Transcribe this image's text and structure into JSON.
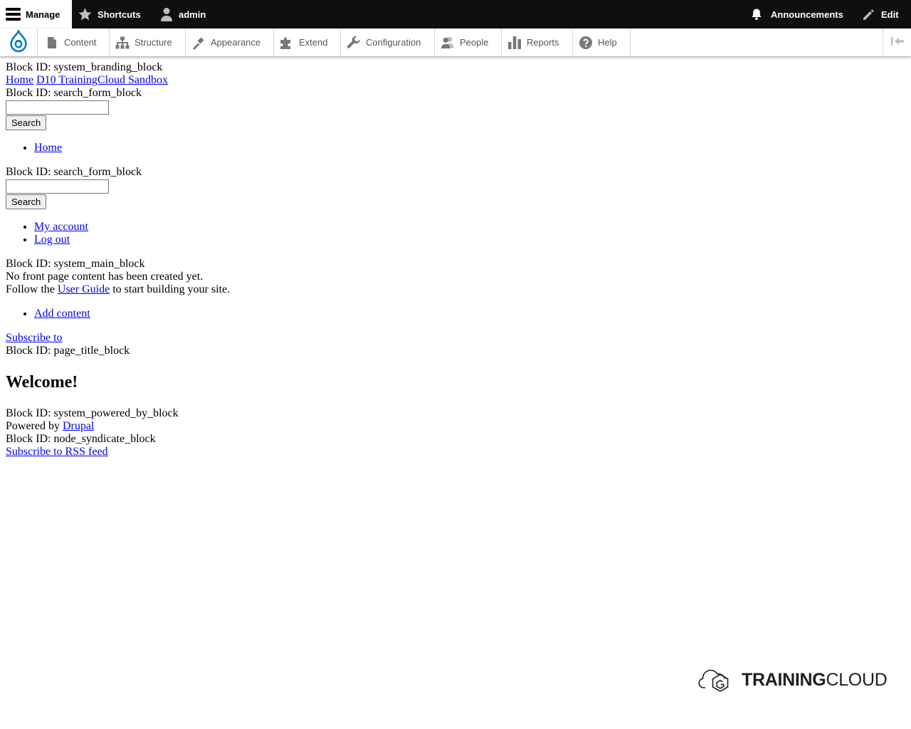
{
  "toolbar": {
    "manage_label": "Manage",
    "shortcuts_label": "Shortcuts",
    "user_label": "admin",
    "announcements_label": "Announcements",
    "edit_label": "Edit"
  },
  "admin_menu": {
    "items": [
      {
        "label": "Content",
        "icon": "file-icon"
      },
      {
        "label": "Structure",
        "icon": "sitemap-icon"
      },
      {
        "label": "Appearance",
        "icon": "paint-brush-icon"
      },
      {
        "label": "Extend",
        "icon": "puzzle-icon"
      },
      {
        "label": "Configuration",
        "icon": "wrench-icon"
      },
      {
        "label": "People",
        "icon": "people-icon"
      },
      {
        "label": "Reports",
        "icon": "bar-chart-icon"
      },
      {
        "label": "Help",
        "icon": "help-icon"
      }
    ]
  },
  "branding": {
    "block_id": "Block ID: system_branding_block",
    "home_logo_alt": "Home",
    "site_name": "D10 TrainingCloud Sandbox"
  },
  "search_block_1": {
    "block_id": "Block ID: search_form_block",
    "input_value": "",
    "button_label": "Search"
  },
  "main_menu": {
    "items": [
      {
        "label": "Home"
      }
    ]
  },
  "search_block_2": {
    "block_id": "Block ID: search_form_block",
    "input_value": "",
    "button_label": "Search"
  },
  "account_menu": {
    "items": [
      {
        "label": "My account"
      },
      {
        "label": "Log out"
      }
    ]
  },
  "main_block": {
    "block_id": "Block ID: system_main_block",
    "empty_message": "No front page content has been created yet.",
    "follow_prefix": "Follow the ",
    "user_guide_link": "User Guide",
    "follow_suffix": " to start building your site.",
    "add_content_link": "Add content",
    "subscribe_link": "Subscribe to"
  },
  "title_block": {
    "block_id": "Block ID: page_title_block",
    "title": "Welcome!"
  },
  "powered_block": {
    "block_id": "Block ID: system_powered_by_block",
    "powered_prefix": "Powered by ",
    "drupal_link": "Drupal"
  },
  "syndicate_block": {
    "block_id": "Block ID: node_syndicate_block",
    "rss_link": "Subscribe to RSS feed"
  },
  "footer_logo": {
    "word_bold": "TRAINING",
    "word_regular": "CLOUD"
  }
}
